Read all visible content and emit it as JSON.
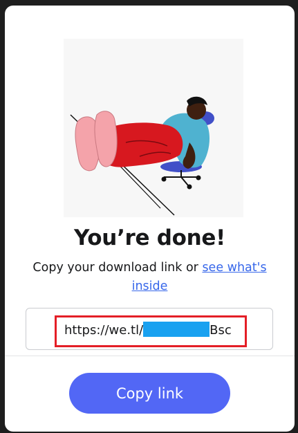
{
  "dialog": {
    "title": "You’re done!",
    "subtitle_text": "Copy your download link or ",
    "see_inside_link": "see what's inside",
    "link_prefix": "https://we.tl/",
    "link_suffix": "Bsc",
    "copy_button_label": "Copy link"
  },
  "colors": {
    "primary_button": "#5267f5",
    "link": "#3767ea",
    "highlight_border": "#e41e26",
    "redaction": "#19a1f0"
  },
  "icons": {
    "illustration": "person-reclining-in-chair-illustration"
  }
}
